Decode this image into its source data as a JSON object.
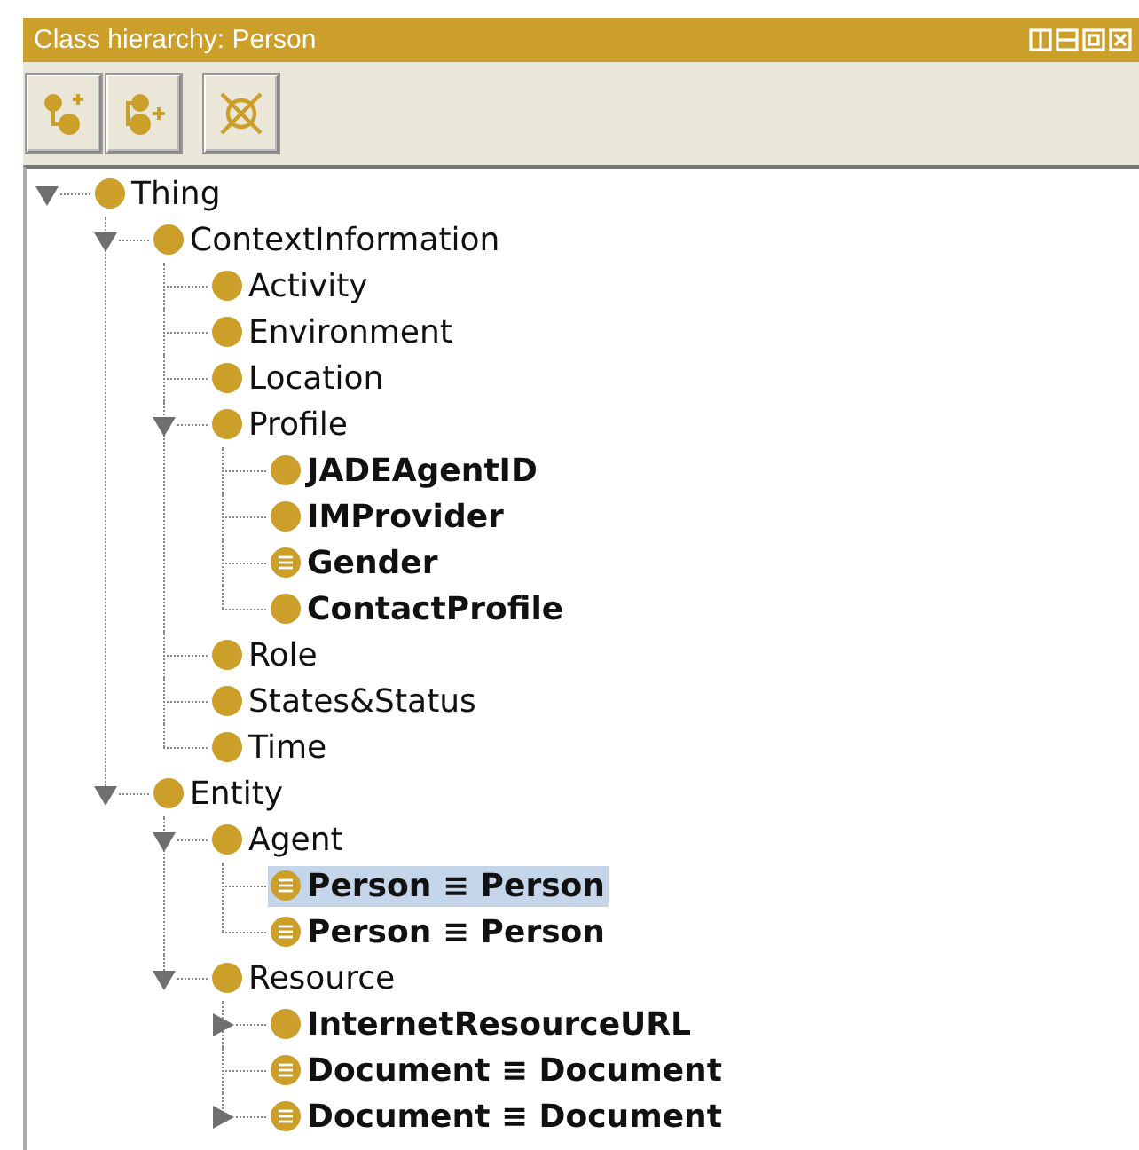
{
  "panel": {
    "title": "Class hierarchy: Person"
  },
  "toolbar": [
    {
      "kind": "add-subclass"
    },
    {
      "kind": "add-sibling"
    },
    {
      "kind": "delete"
    }
  ],
  "tree": [
    {
      "label": "Thing",
      "expanded": true,
      "children": [
        {
          "label": "ContextInformation",
          "expanded": true,
          "children": [
            {
              "label": "Activity"
            },
            {
              "label": "Environment"
            },
            {
              "label": "Location"
            },
            {
              "label": "Profile",
              "expanded": true,
              "children": [
                {
                  "label": "JADEAgentID",
                  "bold": true
                },
                {
                  "label": "IMProvider",
                  "bold": true
                },
                {
                  "label": "Gender",
                  "bold": true,
                  "defined": true
                },
                {
                  "label": "ContactProfile",
                  "bold": true
                }
              ]
            },
            {
              "label": "Role"
            },
            {
              "label": "States&Status"
            },
            {
              "label": "Time"
            }
          ]
        },
        {
          "label": "Entity",
          "expanded": true,
          "children": [
            {
              "label": "Agent",
              "expanded": true,
              "children": [
                {
                  "label": "Person ≡ Person",
                  "bold": true,
                  "defined": true,
                  "selected": true
                },
                {
                  "label": "Person ≡ Person",
                  "bold": true,
                  "defined": true,
                  "selected": false
                }
              ]
            },
            {
              "label": "Resource",
              "expanded": true,
              "children": [
                {
                  "label": "InternetResourceURL",
                  "bold": true,
                  "expanded": false
                },
                {
                  "label": "Document ≡ Document",
                  "bold": true,
                  "defined": true
                },
                {
                  "label": "Document ≡ Document",
                  "bold": true,
                  "defined": true,
                  "expanded": false
                }
              ]
            }
          ]
        }
      ]
    }
  ]
}
